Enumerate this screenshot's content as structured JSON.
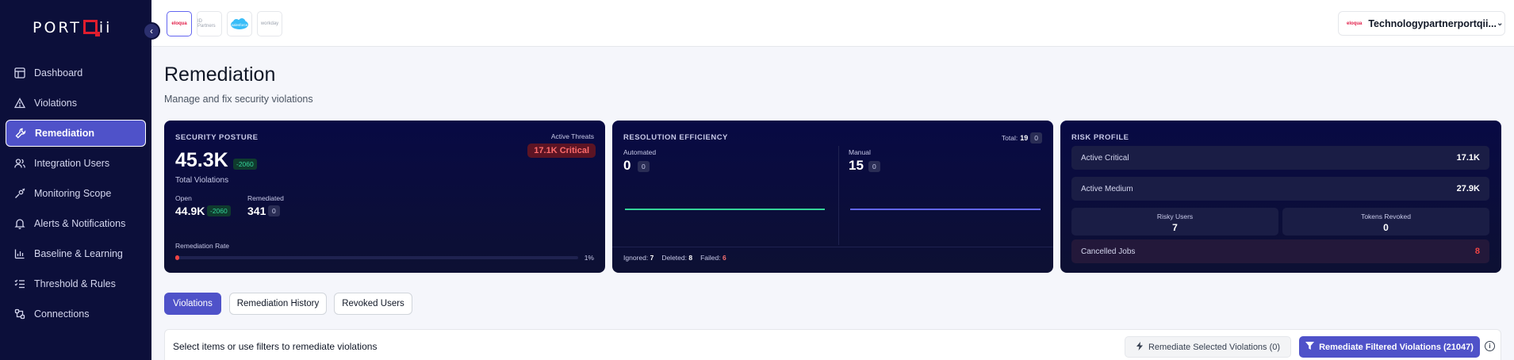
{
  "brand": {
    "logo_left": "PORT",
    "logo_right": "ii"
  },
  "sidebar": {
    "items": [
      {
        "label": "Dashboard",
        "icon": "layout-icon"
      },
      {
        "label": "Violations",
        "icon": "warning-icon"
      },
      {
        "label": "Remediation",
        "icon": "wrench-icon",
        "active": true
      },
      {
        "label": "Integration Users",
        "icon": "users-icon"
      },
      {
        "label": "Monitoring Scope",
        "icon": "scope-icon"
      },
      {
        "label": "Alerts & Notifications",
        "icon": "bell-icon"
      },
      {
        "label": "Baseline & Learning",
        "icon": "chart-icon"
      },
      {
        "label": "Threshold & Rules",
        "icon": "list-icon"
      },
      {
        "label": "Connections",
        "icon": "plug-icon"
      }
    ]
  },
  "topbar": {
    "apps": [
      "eloqua",
      "ID Partners",
      "salesforce",
      "workday"
    ],
    "tenant_mini": "eloqua",
    "tenant": "Technologypartnerportqii..."
  },
  "page": {
    "title": "Remediation",
    "subtitle": "Manage and fix security violations"
  },
  "security_posture": {
    "title": "SECURITY POSTURE",
    "total": "45.3K",
    "total_delta": "-2060",
    "total_label": "Total Violations",
    "open_label": "Open",
    "open_value": "44.9K",
    "open_delta": "-2060",
    "remediated_label": "Remediated",
    "remediated_value": "341",
    "remediated_delta": "0",
    "active_threats_label": "Active Threats",
    "active_threats_badge": "17.1K Critical",
    "rate_label": "Remediation Rate",
    "rate_text": "1%",
    "rate_value": 0.01
  },
  "resolution_efficiency": {
    "title": "RESOLUTION EFFICIENCY",
    "total_label": "Total:",
    "total_value": "19",
    "total_delta": "0",
    "automated_label": "Automated",
    "automated_value": "0",
    "automated_delta": "0",
    "manual_label": "Manual",
    "manual_value": "15",
    "manual_delta": "0",
    "ignored_label": "Ignored:",
    "ignored_value": "7",
    "deleted_label": "Deleted:",
    "deleted_value": "8",
    "failed_label": "Failed:",
    "failed_value": "6",
    "automated_color": "#34d399",
    "manual_color": "#6366f1"
  },
  "risk_profile": {
    "title": "RISK PROFILE",
    "active_critical_label": "Active Critical",
    "active_critical_value": "17.1K",
    "active_medium_label": "Active Medium",
    "active_medium_value": "27.9K",
    "risky_users_label": "Risky Users",
    "risky_users_value": "7",
    "tokens_revoked_label": "Tokens Revoked",
    "tokens_revoked_value": "0",
    "cancelled_jobs_label": "Cancelled Jobs",
    "cancelled_jobs_value": "8"
  },
  "tabs": [
    "Violations",
    "Remediation History",
    "Revoked Users"
  ],
  "actions": {
    "hint": "Select items or use filters to remediate violations",
    "remediate_selected": "Remediate Selected Violations (0)",
    "remediate_filtered": "Remediate Filtered Violations (21047)"
  },
  "colors": {
    "sidebar_bg": "#0c0f3a",
    "accent": "#4f52c9",
    "card_bg": "#080a44",
    "critical": "#ef4444",
    "positive": "#34d399"
  }
}
